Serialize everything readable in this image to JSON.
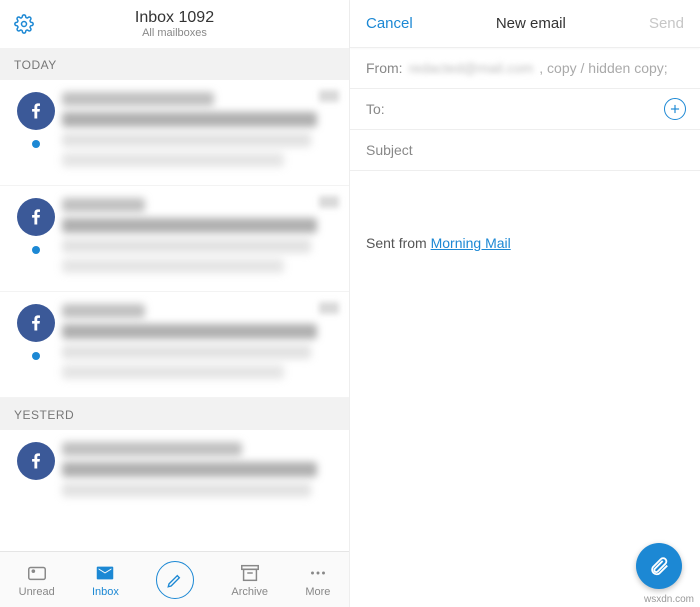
{
  "header": {
    "title_prefix": "Inbox",
    "count": "1092",
    "subtitle": "All mailboxes"
  },
  "sections": [
    {
      "label": "TODAY",
      "items": [
        {
          "avatar_icon": "facebook",
          "unread": true
        },
        {
          "avatar_icon": "facebook",
          "unread": true
        },
        {
          "avatar_icon": "facebook",
          "unread": true
        }
      ]
    },
    {
      "label": "YESTERD",
      "items": [
        {
          "avatar_icon": "facebook",
          "unread": false
        }
      ]
    }
  ],
  "tabs": {
    "unread": "Unread",
    "inbox": "Inbox",
    "archive": "Archive",
    "more": "More"
  },
  "compose": {
    "cancel": "Cancel",
    "title": "New email",
    "send": "Send",
    "from_label": "From:",
    "from_value": "redacted@mail.com",
    "copy_hint": ", copy / hidden copy;",
    "to_label": "To:",
    "subject_label": "Subject",
    "signature_prefix": "Sent from ",
    "signature_link": "Morning Mail"
  },
  "watermark": "wsxdn.com"
}
